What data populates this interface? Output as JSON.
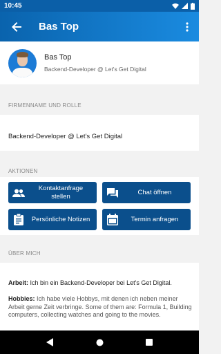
{
  "status": {
    "time": "10:45"
  },
  "app_bar": {
    "title": "Bas Top"
  },
  "profile": {
    "name": "Bas Top",
    "role": "Backend-Developer @ Let's Get Digital"
  },
  "sections": {
    "firm_header": "FIRMENNAME UND ROLLE",
    "firm_value": "Backend-Developer @ Let's Get Digital",
    "actions_header": "AKTIONEN",
    "about_header": "ÜBER MICH"
  },
  "actions": {
    "contact_request": "Kontaktanfrage stellen",
    "open_chat": "Chat öffnen",
    "personal_notes": "Persönliche Notizen",
    "request_appointment": "Termin anfragen"
  },
  "about": {
    "work_label": "Arbeit:",
    "work_text": "Ich bin ein Backend-Developer bei Let's Get Digital.",
    "hobbies_label": "Hobbies:",
    "hobbies_text": "Ich habe viele Hobbys, mit denen ich neben meiner Arbeit gerne Zeit verbringe. Some of them are: Formula 1, Building computers, collecting watches and going to the movies."
  },
  "colors": {
    "primary": "#0b5fa8",
    "button": "#0b4f8c",
    "background": "#f2f2f2"
  }
}
